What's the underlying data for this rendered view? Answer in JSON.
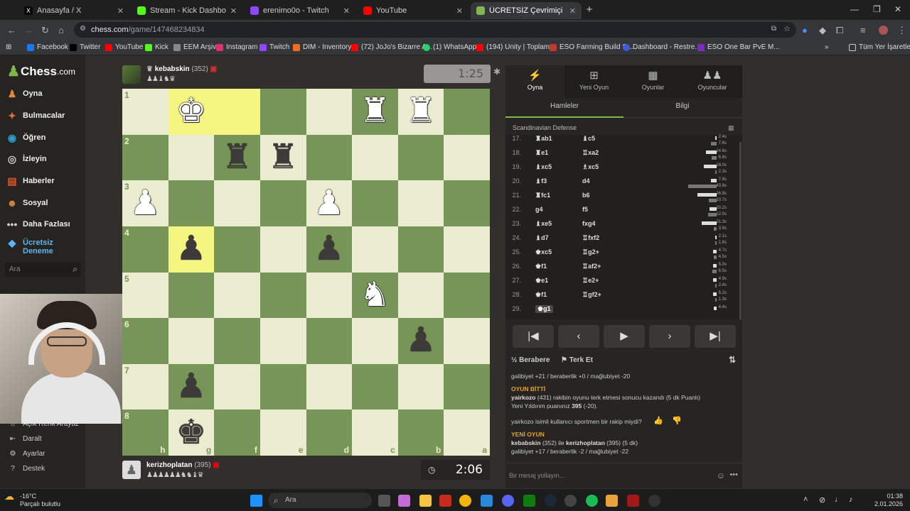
{
  "browser": {
    "tabs": [
      {
        "title": "Anasayfa / X",
        "color": "#000000",
        "active": false
      },
      {
        "title": "Stream - Kick Dashboard",
        "color": "#53fc18",
        "active": false
      },
      {
        "title": "erenimo0o - Twitch",
        "color": "#9146ff",
        "active": false
      },
      {
        "title": "YouTube",
        "color": "#ff0000",
        "active": false
      },
      {
        "title": "ÜCRETSİZ Çevrimiçi Satranç Oy",
        "color": "#81b64c",
        "active": true
      }
    ],
    "url_host": "chess.com",
    "url_path": "/game/147468234834",
    "bookmarks": [
      {
        "label": "Facebook",
        "color": "#1877f2"
      },
      {
        "label": "Twitter",
        "color": "#000000"
      },
      {
        "label": "YouTube",
        "color": "#ff0000"
      },
      {
        "label": "Kick",
        "color": "#53fc18"
      },
      {
        "label": "EEM Arşiv",
        "color": "#888888"
      },
      {
        "label": "Instagram",
        "color": "#e1306c"
      },
      {
        "label": "Twitch",
        "color": "#9146ff"
      },
      {
        "label": "DIM - Inventory",
        "color": "#f26c21"
      },
      {
        "label": "(72) JoJo's Bizarre A...",
        "color": "#ff0000"
      },
      {
        "label": "(1) WhatsApp",
        "color": "#25d366"
      },
      {
        "label": "(194) Unity | Toplam...",
        "color": "#ff0000"
      },
      {
        "label": "ESO Farming Build S...",
        "color": "#c0392b"
      },
      {
        "label": "Dashboard - Restre...",
        "color": "#3b5bdb"
      },
      {
        "label": "ESO One Bar PvE M...",
        "color": "#7b2cbf"
      }
    ],
    "all_bookmarks": "Tüm Yer İşaretleri"
  },
  "sidebar": {
    "logo": "Chess",
    "logo_suffix": ".com",
    "items": [
      {
        "label": "Oyna",
        "icon": "pawn-icon",
        "color": "#e4873a"
      },
      {
        "label": "Bulmacalar",
        "icon": "puzzle-icon",
        "color": "#e06c3a"
      },
      {
        "label": "Öğren",
        "icon": "learn-icon",
        "color": "#2a9fd6"
      },
      {
        "label": "İzleyin",
        "icon": "binoculars-icon",
        "color": "#cfcfcf"
      },
      {
        "label": "Haberler",
        "icon": "news-icon",
        "color": "#e0542a"
      },
      {
        "label": "Sosyal",
        "icon": "social-icon",
        "color": "#e4873a"
      },
      {
        "label": "Daha Fazlası",
        "icon": "more-icon",
        "color": "#cccccc"
      }
    ],
    "trial_line1": "Ücretsiz",
    "trial_line2": "Deneme",
    "search_placeholder": "Ara",
    "lower_items": [
      {
        "label": "Açık Renk Arayüz"
      },
      {
        "label": "Daralt"
      },
      {
        "label": "Ayarlar"
      },
      {
        "label": "Destek"
      }
    ]
  },
  "top_player": {
    "name": "kebabskin",
    "rating": "(352)",
    "captured": "♟♟♝♞♛",
    "clock": "1:25"
  },
  "bottom_player": {
    "name": "kerizhoplatan",
    "rating": "(395)",
    "captured": "♟♟♟♟♟♟♞♞♝♛",
    "clock": "2:06"
  },
  "board": {
    "ranks": [
      "1",
      "2",
      "3",
      "4",
      "5",
      "6",
      "7",
      "8"
    ],
    "files": [
      "h",
      "g",
      "f",
      "e",
      "d",
      "c",
      "b",
      "a"
    ],
    "rows": [
      [
        "",
        "wK",
        "",
        "",
        "",
        "wR",
        "wR",
        ""
      ],
      [
        "",
        "",
        "bR",
        "bR",
        "",
        "",
        "",
        ""
      ],
      [
        "wP",
        "",
        "",
        "",
        "wP",
        "",
        "",
        ""
      ],
      [
        "",
        "bP",
        "",
        "",
        "bP",
        "",
        "",
        ""
      ],
      [
        "",
        "",
        "",
        "",
        "",
        "wN",
        "",
        ""
      ],
      [
        "",
        "",
        "",
        "",
        "",
        "",
        "bP",
        ""
      ],
      [
        "",
        "bP",
        "",
        "",
        "",
        "",
        "",
        ""
      ],
      [
        "",
        "bK",
        "",
        "",
        "",
        "",
        "",
        ""
      ]
    ],
    "highlights": [
      "0-1",
      "0-2",
      "3-1"
    ]
  },
  "panel": {
    "tabs": [
      {
        "label": "Oyna",
        "icon": "lightning-icon"
      },
      {
        "label": "Yeni Oyun",
        "icon": "plus-icon"
      },
      {
        "label": "Oyunlar",
        "icon": "board-icon"
      },
      {
        "label": "Oyuncular",
        "icon": "players-icon"
      }
    ],
    "subtabs": [
      "Hamleler",
      "Bilgi"
    ],
    "opening": "Scandinavian Defense",
    "moves": [
      {
        "n": "17.",
        "w": "♜ab1",
        "b": "♝c5",
        "wt": "2.4s",
        "bt": "7.6s"
      },
      {
        "n": "18.",
        "w": "♜e1",
        "b": "♖xa2",
        "wt": "14.6s",
        "bt": "6.8s"
      },
      {
        "n": "19.",
        "w": "♝xc5",
        "b": "♗xc5",
        "wt": "18.0s",
        "bt": "2.3s"
      },
      {
        "n": "20.",
        "w": "♝f3",
        "b": "d4",
        "wt": "7.8s",
        "bt": "43.9s"
      },
      {
        "n": "21.",
        "w": "♜fc1",
        "b": "b6",
        "wt": "26.8s",
        "bt": "10.7s"
      },
      {
        "n": "22.",
        "w": "g4",
        "b": "f5",
        "wt": "10.2s",
        "bt": "12.0s"
      },
      {
        "n": "23.",
        "w": "♝xe5",
        "b": "fxg4",
        "wt": "21.3s",
        "bt": "3.9s"
      },
      {
        "n": "24.",
        "w": "♝d7",
        "b": "♖fxf2",
        "wt": "2.1s",
        "bt": "1.8s"
      },
      {
        "n": "25.",
        "w": "♚xc5",
        "b": "♖g2+",
        "wt": "4.7s",
        "bt": "4.5s"
      },
      {
        "n": "26.",
        "w": "♚f1",
        "b": "♖af2+",
        "wt": "5.0s",
        "bt": "6.5s"
      },
      {
        "n": "27.",
        "w": "♚e1",
        "b": "♖e2+",
        "wt": "4.9s",
        "bt": "2.4s"
      },
      {
        "n": "28.",
        "w": "♚f1",
        "b": "♖gf2+",
        "wt": "5.2s",
        "bt": "1.3s"
      },
      {
        "n": "29.",
        "w": "♚g1",
        "b": "",
        "wt": "4.4s",
        "bt": ""
      }
    ],
    "actions": {
      "draw": "Berabere",
      "resign": "Terk Et"
    },
    "chat": {
      "line1": "galibiyet +21 / beraberlik +0 / mağlubiyet -20",
      "over_title": "OYUN BİTTİ",
      "over_user": "yairkozo",
      "over_text": " (431) rakibin oyunu terk etmesi sonucu kazandı (5 dk Puanlı)",
      "rating_prefix": "Yeni Yıldırım puanınız ",
      "rating_value": "395",
      "rating_suffix": " (-20).",
      "question": "yairkozo isimli kullanıcı sportmen bir rakip miydi?",
      "new_title": "YENİ OYUN",
      "new_p1": "kebabskin",
      "new_r1": " (352) ile ",
      "new_p2": "kerizhoplatan",
      "new_r2": " (395) (5 dk)",
      "line_last": "galibiyet +17 / beraberlik -2 / mağlubiyet -22"
    },
    "message_placeholder": "Bir mesaj yollayın..."
  },
  "taskbar": {
    "temp": "-16°C",
    "weather": "Parçalı bulutlu",
    "search": "Ara",
    "time": "01:38",
    "date": "2.01.2026"
  }
}
